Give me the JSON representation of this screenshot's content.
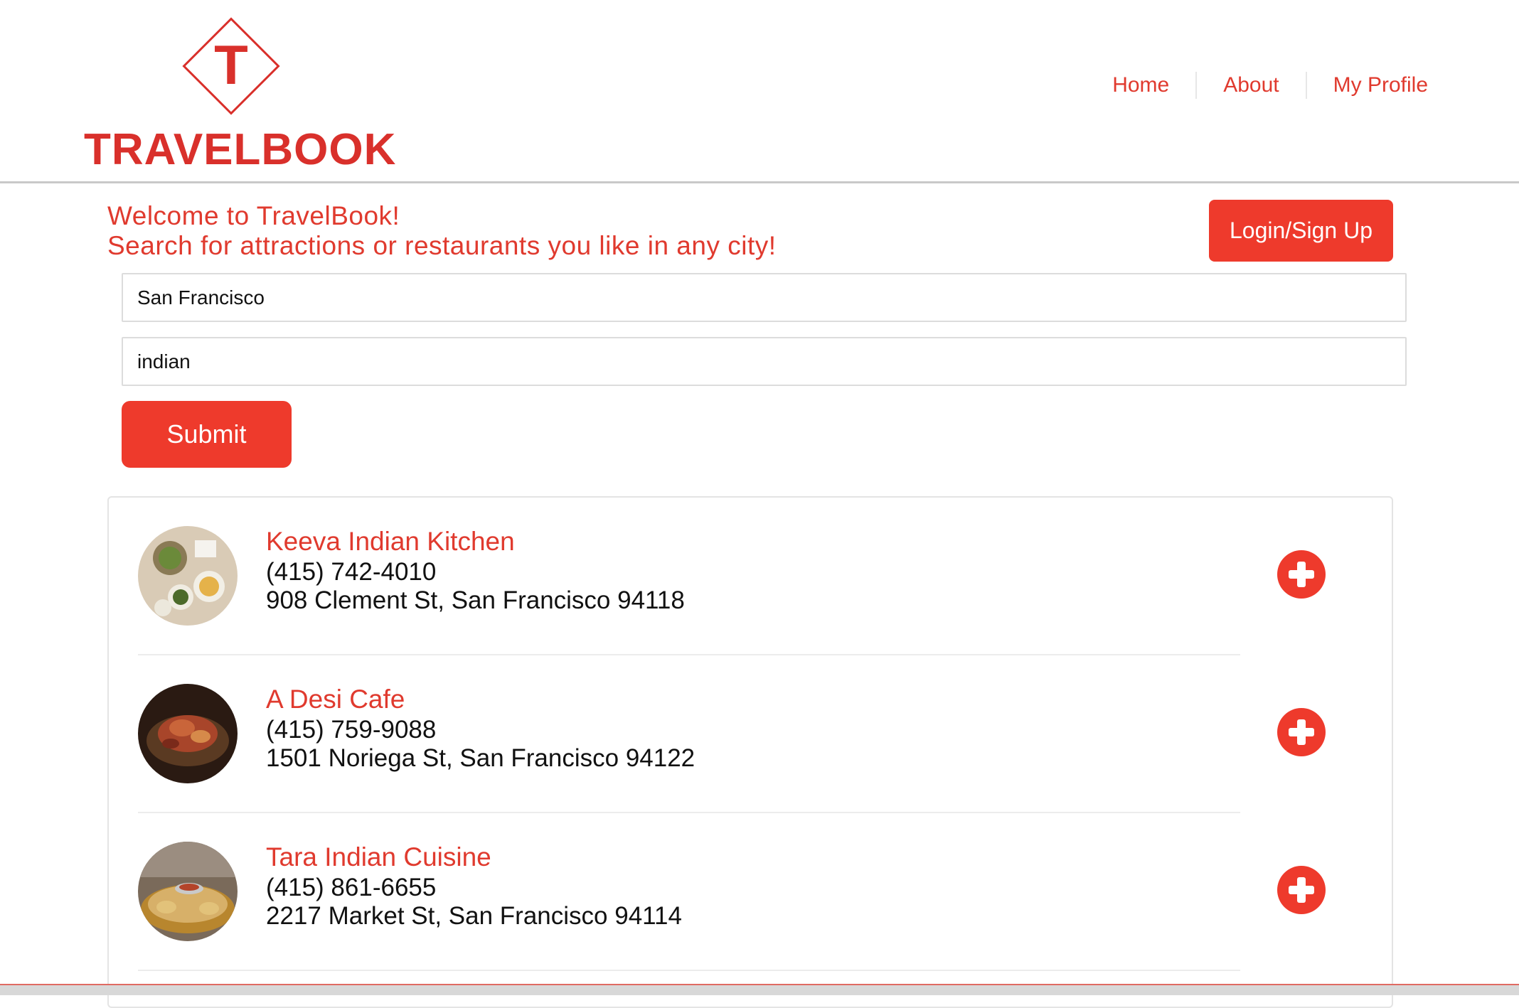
{
  "brand": {
    "name": "TRAVELBOOK",
    "mark_letter": "T",
    "color": "#d9302b"
  },
  "nav": {
    "items": [
      {
        "label": "Home"
      },
      {
        "label": "About"
      },
      {
        "label": "My Profile"
      }
    ]
  },
  "welcome": {
    "line1": "Welcome to TravelBook!",
    "line2": "Search for attractions or restaurants you like in any city!"
  },
  "login_button": {
    "label": "Login/Sign Up"
  },
  "search": {
    "city_value": "San Francisco",
    "term_value": "indian",
    "submit_label": "Submit"
  },
  "results": [
    {
      "name": "Keeva Indian Kitchen",
      "phone": "(415) 742-4010",
      "address": "908 Clement St, San Francisco 94118",
      "thumb_icon": "restaurant-photo-icon"
    },
    {
      "name": "A Desi Cafe",
      "phone": "(415) 759-9088",
      "address": "1501 Noriega St, San Francisco 94122",
      "thumb_icon": "restaurant-photo-icon"
    },
    {
      "name": "Tara Indian Cuisine",
      "phone": "(415) 861-6655",
      "address": "2217 Market St, San Francisco 94114",
      "thumb_icon": "restaurant-photo-icon"
    }
  ],
  "add_icon": "plus-circle-icon",
  "colors": {
    "accent": "#ee3a2c",
    "accent_text": "#e03a2e"
  }
}
